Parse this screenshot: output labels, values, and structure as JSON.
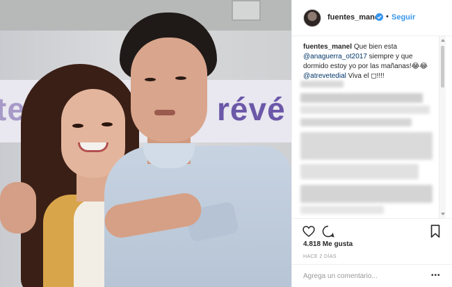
{
  "post": {
    "username": "fuentes_manel",
    "separator": "•",
    "follow_label": "Seguir",
    "caption": {
      "username": "fuentes_manel",
      "text_1": "Que bien esta",
      "mention_1": "@anaguerra_ot2017",
      "text_2": "siempre y que dormido estoy yo por las mañanas!😂😂",
      "mention_2": "@atrevetedial",
      "text_3": "Viva el ◻!!!!"
    },
    "likes": "4.818 Me gusta",
    "time": "HACE 2 DÍAS",
    "comment_placeholder": "Agrega un comentario...",
    "more_label": "•••"
  },
  "photo": {
    "banner_left": "te",
    "banner_right": "révé"
  },
  "icons": {
    "verified": "verified-badge-icon",
    "heart": "heart-icon",
    "comment": "comment-icon",
    "bookmark": "bookmark-icon",
    "more": "more-options-icon"
  },
  "colors": {
    "link_blue": "#3897f0",
    "mention_blue": "#003569",
    "text": "#262626",
    "muted": "#999999"
  }
}
